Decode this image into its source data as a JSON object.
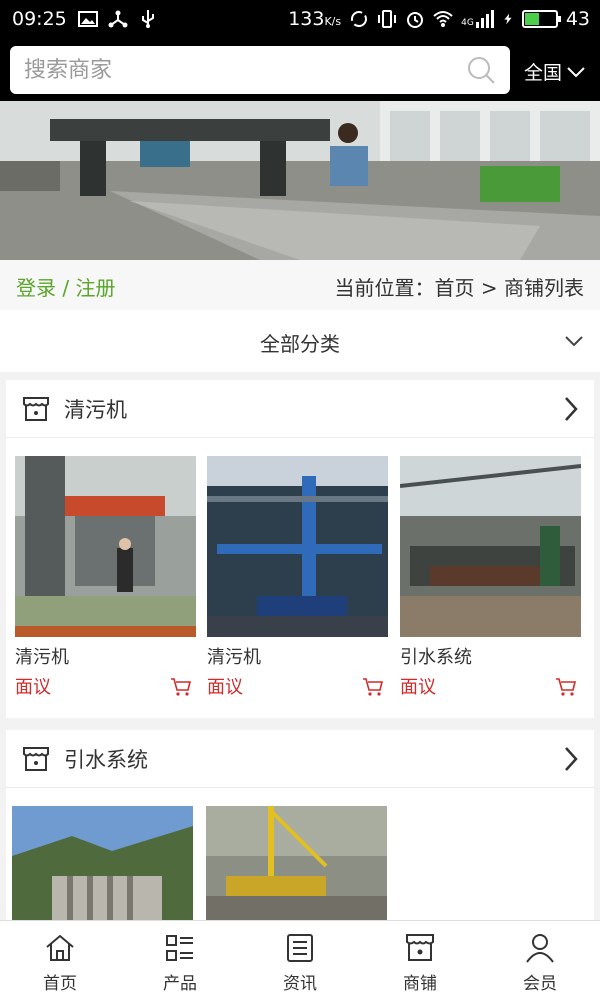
{
  "status_bar": {
    "time": "09:25",
    "speed": "133",
    "speed_unit": "K/s",
    "network": "4G",
    "battery": "43",
    "battery_level": 0.43
  },
  "search": {
    "placeholder": "搜索商家",
    "region": "全国"
  },
  "breadcrumb": {
    "login": "登录 / 注册",
    "location": "当前位置：首页 > 商铺列表"
  },
  "category_selector": {
    "label": "全部分类"
  },
  "sections": [
    {
      "title": "清污机",
      "items": [
        {
          "name": "清污机",
          "price": "面议"
        },
        {
          "name": "清污机",
          "price": "面议"
        },
        {
          "name": "引水系统",
          "price": "面议"
        }
      ]
    },
    {
      "title": "引水系统",
      "items": [
        {
          "name": "",
          "price": ""
        },
        {
          "name": "",
          "price": ""
        }
      ]
    }
  ],
  "bottom_nav": [
    {
      "label": "首页",
      "icon": "home-icon"
    },
    {
      "label": "产品",
      "icon": "list-icon"
    },
    {
      "label": "资讯",
      "icon": "news-icon"
    },
    {
      "label": "商铺",
      "icon": "shop-icon"
    },
    {
      "label": "会员",
      "icon": "user-icon"
    }
  ],
  "colors": {
    "accent_green": "#5aa52a",
    "price_red": "#d12b2b",
    "header_bg": "#000000"
  }
}
